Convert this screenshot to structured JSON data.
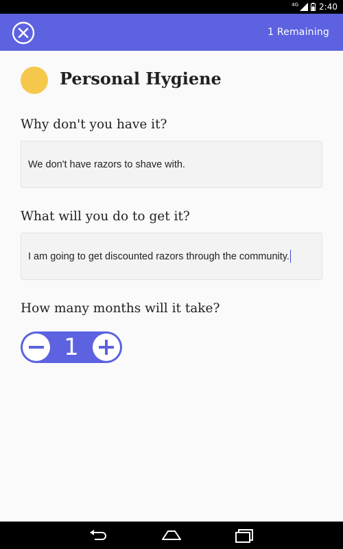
{
  "status_bar": {
    "network": "4G",
    "time": "2:40"
  },
  "app_bar": {
    "close_icon": "close-circle-icon",
    "remaining_label": "1 Remaining",
    "background_color": "#5c62e0"
  },
  "header": {
    "title": "Personal Hygiene",
    "dot_color": "#f5c84b"
  },
  "questions": [
    {
      "label": "Why don't you have it?",
      "answer": "We don't have razors to shave with."
    },
    {
      "label": "What will you do to get it?",
      "answer": "I am going to get discounted razors through the community."
    },
    {
      "label": "How many months will it take?"
    }
  ],
  "stepper": {
    "value": "1",
    "minus_icon": "minus-icon",
    "plus_icon": "plus-icon"
  },
  "nav_bar": {
    "back_icon": "back-icon",
    "home_icon": "home-icon",
    "recents_icon": "recents-icon"
  }
}
